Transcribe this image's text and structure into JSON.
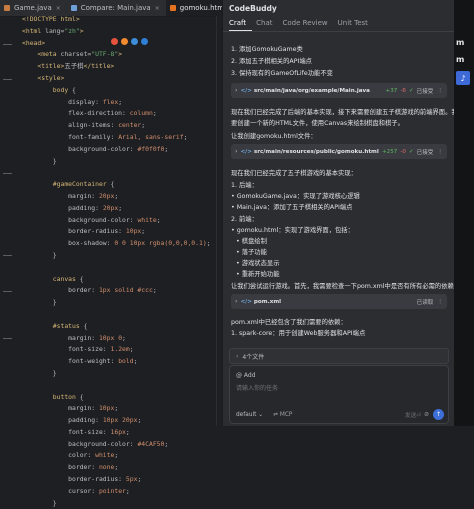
{
  "editor": {
    "tabs": [
      {
        "label": "Game.java"
      },
      {
        "label": "Compare: Main.java"
      },
      {
        "label": "gomoku.html"
      }
    ],
    "close_glyph": "×",
    "code_lines": [
      [
        {
          "c": "tg",
          "t": "<!DOCTYPE html>"
        }
      ],
      [
        {
          "c": "tg",
          "t": "<html "
        },
        {
          "c": "at",
          "t": "lang="
        },
        {
          "c": "st",
          "t": "\"zh\""
        },
        {
          "c": "tg",
          "t": ">"
        }
      ],
      [
        {
          "c": "tg",
          "t": "<head>"
        }
      ],
      [
        {
          "c": "tg",
          "t": "    <meta "
        },
        {
          "c": "at",
          "t": "charset="
        },
        {
          "c": "st",
          "t": "\"UTF-8\""
        },
        {
          "c": "tg",
          "t": ">"
        }
      ],
      [
        {
          "c": "tg",
          "t": "    <title>"
        },
        {
          "c": "tx",
          "t": "五子棋"
        },
        {
          "c": "tg",
          "t": "</title>"
        }
      ],
      [
        {
          "c": "tg",
          "t": "    <style>"
        }
      ],
      [
        {
          "c": "sel",
          "t": "        body "
        },
        {
          "c": "tx",
          "t": "{"
        }
      ],
      [
        {
          "c": "pr",
          "t": "            display: "
        },
        {
          "c": "vl",
          "t": "flex"
        },
        {
          "c": "tx",
          "t": ";"
        }
      ],
      [
        {
          "c": "pr",
          "t": "            flex-direction: "
        },
        {
          "c": "vl",
          "t": "column"
        },
        {
          "c": "tx",
          "t": ";"
        }
      ],
      [
        {
          "c": "pr",
          "t": "            align-items: "
        },
        {
          "c": "vl",
          "t": "center"
        },
        {
          "c": "tx",
          "t": ";"
        }
      ],
      [
        {
          "c": "pr",
          "t": "            font-family: "
        },
        {
          "c": "vl",
          "t": "Arial, sans-serif"
        },
        {
          "c": "tx",
          "t": ";"
        }
      ],
      [
        {
          "c": "pr",
          "t": "            background-color: "
        },
        {
          "c": "vl",
          "t": "#f0f0f0"
        },
        {
          "c": "tx",
          "t": ";"
        }
      ],
      [
        {
          "c": "tx",
          "t": "        }"
        }
      ],
      [
        {
          "c": "tx",
          "t": ""
        }
      ],
      [
        {
          "c": "sel",
          "t": "        #gameContainer "
        },
        {
          "c": "tx",
          "t": "{"
        }
      ],
      [
        {
          "c": "pr",
          "t": "            margin: "
        },
        {
          "c": "vl",
          "t": "20px"
        },
        {
          "c": "tx",
          "t": ";"
        }
      ],
      [
        {
          "c": "pr",
          "t": "            padding: "
        },
        {
          "c": "vl",
          "t": "20px"
        },
        {
          "c": "tx",
          "t": ";"
        }
      ],
      [
        {
          "c": "pr",
          "t": "            background-color: "
        },
        {
          "c": "vl",
          "t": "white"
        },
        {
          "c": "tx",
          "t": ";"
        }
      ],
      [
        {
          "c": "pr",
          "t": "            border-radius: "
        },
        {
          "c": "vl",
          "t": "10px"
        },
        {
          "c": "tx",
          "t": ";"
        }
      ],
      [
        {
          "c": "pr",
          "t": "            box-shadow: "
        },
        {
          "c": "vl",
          "t": "0 0 10px rgba(0,0,0,0.1)"
        },
        {
          "c": "tx",
          "t": ";"
        }
      ],
      [
        {
          "c": "tx",
          "t": "        }"
        }
      ],
      [
        {
          "c": "tx",
          "t": ""
        }
      ],
      [
        {
          "c": "sel",
          "t": "        canvas "
        },
        {
          "c": "tx",
          "t": "{"
        }
      ],
      [
        {
          "c": "pr",
          "t": "            border: "
        },
        {
          "c": "vl",
          "t": "1px solid #ccc"
        },
        {
          "c": "tx",
          "t": ";"
        }
      ],
      [
        {
          "c": "tx",
          "t": "        }"
        }
      ],
      [
        {
          "c": "tx",
          "t": ""
        }
      ],
      [
        {
          "c": "sel",
          "t": "        #status "
        },
        {
          "c": "tx",
          "t": "{"
        }
      ],
      [
        {
          "c": "pr",
          "t": "            margin: "
        },
        {
          "c": "vl",
          "t": "10px 0"
        },
        {
          "c": "tx",
          "t": ";"
        }
      ],
      [
        {
          "c": "pr",
          "t": "            font-size: "
        },
        {
          "c": "vl",
          "t": "1.2em"
        },
        {
          "c": "tx",
          "t": ";"
        }
      ],
      [
        {
          "c": "pr",
          "t": "            font-weight: "
        },
        {
          "c": "vl",
          "t": "bold"
        },
        {
          "c": "tx",
          "t": ";"
        }
      ],
      [
        {
          "c": "tx",
          "t": "        }"
        }
      ],
      [
        {
          "c": "tx",
          "t": ""
        }
      ],
      [
        {
          "c": "sel",
          "t": "        button "
        },
        {
          "c": "tx",
          "t": "{"
        }
      ],
      [
        {
          "c": "pr",
          "t": "            margin: "
        },
        {
          "c": "vl",
          "t": "10px"
        },
        {
          "c": "tx",
          "t": ";"
        }
      ],
      [
        {
          "c": "pr",
          "t": "            padding: "
        },
        {
          "c": "vl",
          "t": "10px 20px"
        },
        {
          "c": "tx",
          "t": ";"
        }
      ],
      [
        {
          "c": "pr",
          "t": "            font-size: "
        },
        {
          "c": "vl",
          "t": "16px"
        },
        {
          "c": "tx",
          "t": ";"
        }
      ],
      [
        {
          "c": "pr",
          "t": "            background-color: "
        },
        {
          "c": "vl",
          "t": "#4CAF50"
        },
        {
          "c": "tx",
          "t": ";"
        }
      ],
      [
        {
          "c": "pr",
          "t": "            color: "
        },
        {
          "c": "vl",
          "t": "white"
        },
        {
          "c": "tx",
          "t": ";"
        }
      ],
      [
        {
          "c": "pr",
          "t": "            border: "
        },
        {
          "c": "vl",
          "t": "none"
        },
        {
          "c": "tx",
          "t": ";"
        }
      ],
      [
        {
          "c": "pr",
          "t": "            border-radius: "
        },
        {
          "c": "vl",
          "t": "5px"
        },
        {
          "c": "tx",
          "t": ";"
        }
      ],
      [
        {
          "c": "pr",
          "t": "            cursor: "
        },
        {
          "c": "vl",
          "t": "pointer"
        },
        {
          "c": "tx",
          "t": ";"
        }
      ],
      [
        {
          "c": "tx",
          "t": "        }"
        }
      ]
    ],
    "syntax_colors": {
      "tag": "#d5b778",
      "attr": "#bababa",
      "string": "#6aab73",
      "property": "#bcbec4",
      "value": "#cf8e6d"
    },
    "browser_badges": [
      {
        "name": "chrome-icon",
        "color": "#e5533d"
      },
      {
        "name": "firefox-icon",
        "color": "#f28a2f"
      },
      {
        "name": "safari-icon",
        "color": "#3d8ddb"
      },
      {
        "name": "edge-icon",
        "color": "#2f7fd6"
      }
    ]
  },
  "panel": {
    "title": "CodeBuddy",
    "tabs": [
      "Craft",
      "Chat",
      "Code Review",
      "Unit Test"
    ],
    "active_tab": "Craft",
    "messages": {
      "step1": "1. 添加GomokuGame类",
      "step2": "2. 添加五子棋相关的API端点",
      "step3": "3. 保持现有的GameOfLife功能不变",
      "intro": "现在我们已经完成了后端的基本实现，接下来需要创建五子棋游戏的前端界面。我们需",
      "intro2": "要创建一个新的HTML文件，使用Canvas来绘制棋盘和棋子。",
      "create_html": "让我创建gomoku.html文件：",
      "summary": "现在我们已经完成了五子棋游戏的基本实现：",
      "backend_h": "1. 后端：",
      "backend_1": "• GomokuGame.java：实现了游戏核心逻辑",
      "backend_2": "• Main.java：添加了五子棋相关的API端点",
      "frontend_h": "2. 前端：",
      "frontend_1": "• gomoku.html：实现了游戏界面，包括：",
      "frontend_f1": "• 棋盘绘制",
      "frontend_f2": "• 落子功能",
      "frontend_f3": "• 游戏状态显示",
      "frontend_f4": "• 重新开始功能",
      "check": "让我们尝试运行游戏。首先，我需要检查一下pom.xml中是否有所有必需的依赖：",
      "pom_text": "pom.xml中已经包含了我们需要的依赖：",
      "spark": "1. spark-core：用于创建Web服务器和API端点"
    },
    "cards": [
      {
        "path": "src/main/java/org/example/Main.java",
        "added": "+37",
        "removed": "-6",
        "status": "已接受"
      },
      {
        "path": "src/main/resources/public/gomoku.html",
        "added": "+257",
        "removed": "-0",
        "status": "已接受"
      },
      {
        "path": "pom.xml",
        "added": "",
        "removed": "",
        "status": "已读取"
      }
    ],
    "files_label": "4个文件",
    "input": {
      "add_context": "@ Add",
      "placeholder": "请输入你的任务",
      "model": "default",
      "mcp": "MCP",
      "send_hint": "发送⏎"
    }
  },
  "strip": {
    "letters": [
      "m",
      "m"
    ],
    "button_glyph": "♪"
  }
}
